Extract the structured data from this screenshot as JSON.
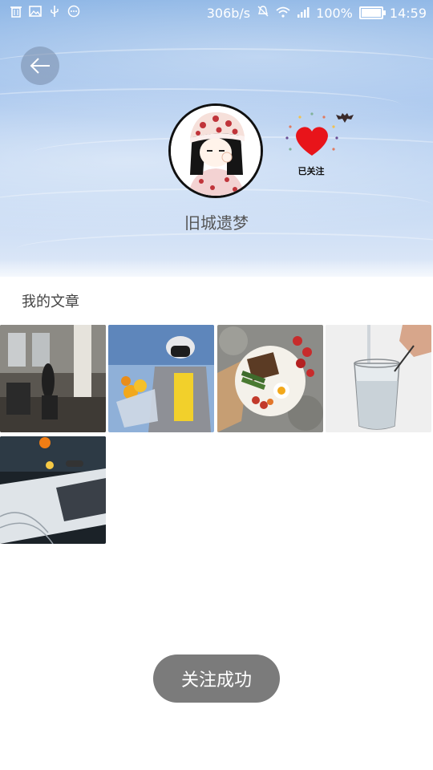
{
  "status_bar": {
    "network_speed": "306b/s",
    "battery": "100%",
    "time": "14:59",
    "left_icons": [
      "trash-icon",
      "image-icon",
      "usb-icon",
      "more-icon"
    ],
    "right_icons": [
      "mute-icon",
      "wifi-icon",
      "signal-icon",
      "battery-icon"
    ]
  },
  "profile": {
    "username": "旧城遗梦",
    "follow_status": "已关注"
  },
  "articles": {
    "title": "我的文章",
    "items": [
      {
        "name": "gym-photo"
      },
      {
        "name": "bouquet-photo"
      },
      {
        "name": "food-plate-photo"
      },
      {
        "name": "water-glass-photo"
      },
      {
        "name": "desk-photo"
      }
    ]
  },
  "toast": {
    "message": "关注成功"
  },
  "colors": {
    "header_sky": "#a9c7ee",
    "toast_bg": "#7b7b7b",
    "heart": "#e8141a"
  }
}
